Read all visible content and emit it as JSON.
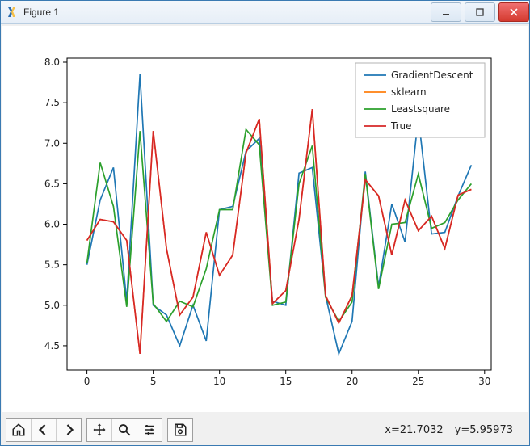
{
  "window": {
    "title": "Figure 1"
  },
  "status": {
    "x_label": "x=21.7032",
    "y_label": "y=5.95973"
  },
  "chart_data": {
    "type": "line",
    "x": [
      0,
      1,
      2,
      3,
      4,
      5,
      6,
      7,
      8,
      9,
      10,
      11,
      12,
      13,
      14,
      15,
      16,
      17,
      18,
      19,
      20,
      21,
      22,
      23,
      24,
      25,
      26,
      27,
      28,
      29
    ],
    "series": [
      {
        "name": "GradientDescent",
        "color": "#1f77b4",
        "values": [
          5.5,
          6.3,
          6.7,
          5.05,
          7.85,
          5.0,
          4.88,
          4.5,
          5.0,
          4.56,
          6.18,
          6.22,
          6.9,
          7.06,
          5.05,
          5.0,
          6.63,
          6.7,
          5.12,
          4.4,
          4.8,
          6.65,
          5.23,
          6.25,
          5.78,
          7.33,
          5.88,
          5.9,
          6.35,
          6.73
        ]
      },
      {
        "name": "sklearn",
        "color": "#ff7f0e",
        "values": [
          5.8,
          6.06,
          6.03,
          5.8,
          4.4,
          7.15,
          5.7,
          4.88,
          5.1,
          5.9,
          5.37,
          5.62,
          6.88,
          7.3,
          5.02,
          5.18,
          6.06,
          7.42,
          5.12,
          4.78,
          5.12,
          6.55,
          6.35,
          5.62,
          6.3,
          5.92,
          6.1,
          5.7,
          6.36,
          6.43
        ]
      },
      {
        "name": "Leastsquare",
        "color": "#2ca02c",
        "values": [
          5.52,
          6.76,
          6.22,
          4.98,
          7.15,
          5.02,
          4.8,
          5.05,
          4.98,
          5.45,
          6.18,
          6.18,
          7.17,
          6.98,
          5.0,
          5.04,
          6.5,
          6.97,
          5.1,
          4.8,
          5.04,
          6.62,
          5.2,
          6.0,
          6.02,
          6.62,
          5.95,
          6.02,
          6.3,
          6.5
        ]
      },
      {
        "name": "True",
        "color": "#d62728",
        "values": [
          5.8,
          6.06,
          6.03,
          5.8,
          4.4,
          7.15,
          5.7,
          4.88,
          5.1,
          5.9,
          5.37,
          5.62,
          6.88,
          7.3,
          5.02,
          5.18,
          6.06,
          7.42,
          5.12,
          4.78,
          5.12,
          6.55,
          6.35,
          5.62,
          6.3,
          5.92,
          6.1,
          5.7,
          6.36,
          6.43
        ]
      }
    ],
    "xticks": [
      0,
      5,
      10,
      15,
      20,
      25,
      30
    ],
    "yticks": [
      4.5,
      5.0,
      5.5,
      6.0,
      6.5,
      7.0,
      7.5,
      8.0
    ],
    "xlim": [
      -1.5,
      30.5
    ],
    "ylim": [
      4.2,
      8.05
    ],
    "legend_pos": "upper-right"
  }
}
